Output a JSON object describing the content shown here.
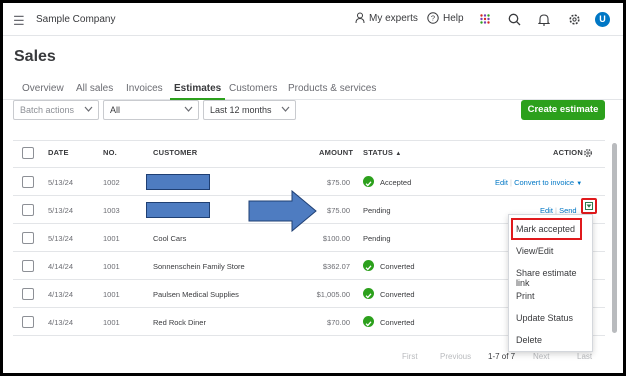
{
  "header": {
    "company": "Sample Company",
    "my_experts": "My experts",
    "help": "Help",
    "avatar_initial": "U"
  },
  "page": {
    "title": "Sales"
  },
  "tabs": [
    {
      "label": "Overview"
    },
    {
      "label": "All sales"
    },
    {
      "label": "Invoices"
    },
    {
      "label": "Estimates",
      "active": true
    },
    {
      "label": "Customers"
    },
    {
      "label": "Products & services"
    }
  ],
  "filters": {
    "batch_actions": "Batch actions",
    "type": "All",
    "date_range": "Last 12 months",
    "create_button": "Create estimate"
  },
  "table": {
    "headers": {
      "date": "DATE",
      "no": "NO.",
      "customer": "CUSTOMER",
      "amount": "AMOUNT",
      "status": "STATUS",
      "status_sort": "▲",
      "action": "ACTION"
    },
    "rows": [
      {
        "date": "5/13/24",
        "no": "1002",
        "customer": "",
        "amount": "$75.00",
        "status": "Accepted",
        "action_primary": "Edit",
        "action_secondary": "Convert to invoice"
      },
      {
        "date": "5/13/24",
        "no": "1003",
        "customer": "",
        "amount": "$75.00",
        "status": "Pending",
        "action_primary": "Edit",
        "action_secondary": "Send"
      },
      {
        "date": "5/13/24",
        "no": "1001",
        "customer": "Cool Cars",
        "amount": "$100.00",
        "status": "Pending"
      },
      {
        "date": "4/14/24",
        "no": "1001",
        "customer": "Sonnenschein Family Store",
        "amount": "$362.07",
        "status": "Converted"
      },
      {
        "date": "4/13/24",
        "no": "1001",
        "customer": "Paulsen Medical Supplies",
        "amount": "$1,005.00",
        "status": "Converted"
      },
      {
        "date": "4/13/24",
        "no": "1001",
        "customer": "Red Rock Diner",
        "amount": "$70.00",
        "status": "Converted"
      }
    ]
  },
  "action_menu": {
    "items": [
      "Mark accepted",
      "View/Edit",
      "Share estimate link",
      "Print",
      "Update Status",
      "Delete"
    ]
  },
  "pagination": {
    "first": "First",
    "previous": "Previous",
    "range": "1-7 of 7",
    "next": "Next",
    "last": "Last"
  },
  "colors": {
    "accent_green": "#2ca01c",
    "link_blue": "#0077c5",
    "highlight_red": "#e0191c",
    "annotation_blue": "#4e7cc1"
  }
}
